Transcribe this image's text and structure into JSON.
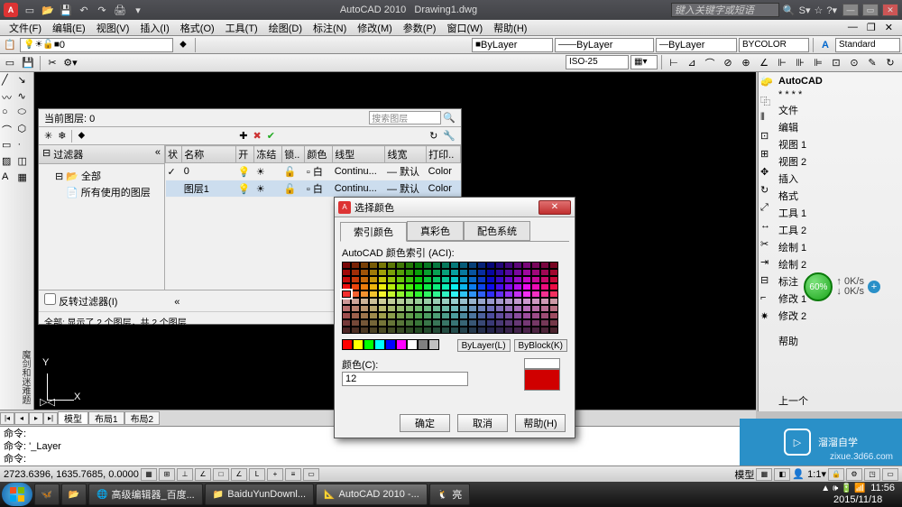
{
  "titlebar": {
    "app": "AutoCAD 2010",
    "doc": "Drawing1.dwg",
    "search_placeholder": "键入关键字或短语"
  },
  "menu": [
    "文件(F)",
    "编辑(E)",
    "视图(V)",
    "插入(I)",
    "格式(O)",
    "工具(T)",
    "绘图(D)",
    "标注(N)",
    "修改(M)",
    "参数(P)",
    "窗口(W)",
    "帮助(H)"
  ],
  "layer_dd": "0",
  "props": {
    "bylayer1": "ByLayer",
    "bylayer2": "ByLayer",
    "bylayer3": "ByLayer",
    "bycolor": "BYCOLOR",
    "style": "Standard"
  },
  "layerpanel": {
    "current": "当前图层: 0",
    "search_placeholder": "搜索图层",
    "filter_hdr": "过滤器",
    "filter_icon": "«",
    "tree": {
      "all": "全部",
      "used": "所有使用的图层"
    },
    "invert": "反转过滤器(I)",
    "cols": [
      "状",
      "名称",
      "开",
      "冻结",
      "锁..",
      "颜色",
      "线型",
      "线宽",
      "打印.."
    ],
    "rows": [
      {
        "state": "✓",
        "name": "0",
        "on": "💡",
        "freeze": "☀",
        "lock": "🔓",
        "color": "白",
        "ltype": "Continu...",
        "lw": "— 默认",
        "plot": "Color"
      },
      {
        "state": "",
        "name": "图层1",
        "on": "💡",
        "freeze": "☀",
        "lock": "🔓",
        "color": "白",
        "ltype": "Continu...",
        "lw": "— 默认",
        "plot": "Color"
      }
    ],
    "footer": "全部: 显示了 2 个图层，共 2 个图层"
  },
  "colordlg": {
    "title": "选择颜色",
    "tabs": [
      "索引颜色",
      "真彩色",
      "配色系统"
    ],
    "aci_label": "AutoCAD 颜色索引 (ACI):",
    "bylayer_btn": "ByLayer(L)",
    "byblock_btn": "ByBlock(K)",
    "color_label": "颜色(C):",
    "color_value": "12",
    "ok": "确定",
    "cancel": "取消",
    "help": "帮助(H)",
    "basic_colors": [
      "#ff0000",
      "#ffff00",
      "#00ff00",
      "#00ffff",
      "#0000ff",
      "#ff00ff",
      "#ffffff",
      "#808080",
      "#c0c0c0"
    ],
    "gray_colors": [
      "#202020",
      "#404040",
      "#606060",
      "#808080",
      "#a0a0a0",
      "#c0c0c0"
    ],
    "selected_index": 12,
    "preview_new": "#d00000"
  },
  "tabs": {
    "model": "模型",
    "layout1": "布局1",
    "layout2": "布局2"
  },
  "cmd": {
    "l1": "命令:",
    "l2": "命令: '_Layer",
    "l3": "命令:"
  },
  "status": {
    "coords": "2723.6396, 1635.7685, 0.0000",
    "right": [
      "模型",
      "▦",
      "◧"
    ]
  },
  "rightpanel": {
    "head": "AutoCAD",
    "dots": "* * * *",
    "items": [
      "文件",
      "编辑",
      "视图 1",
      "视图 2",
      "插入",
      "格式",
      "工具 1",
      "工具 2",
      "绘制 1",
      "绘制 2",
      "标注",
      "修改 1",
      "修改 2",
      "",
      "帮助"
    ],
    "prev": "上一个"
  },
  "speed": {
    "pct": "60%",
    "up": "↑  0K/s",
    "down": "↓  0K/s"
  },
  "taskbar": {
    "items": [
      "高级编辑器_百度...",
      "BaiduYunDownl...",
      "AutoCAD 2010 -...",
      "亮"
    ],
    "time": "11:56",
    "date": "2015/11/18"
  },
  "watermark": {
    "text": "溜溜自学",
    "sub": "zixue.3d66.com"
  }
}
